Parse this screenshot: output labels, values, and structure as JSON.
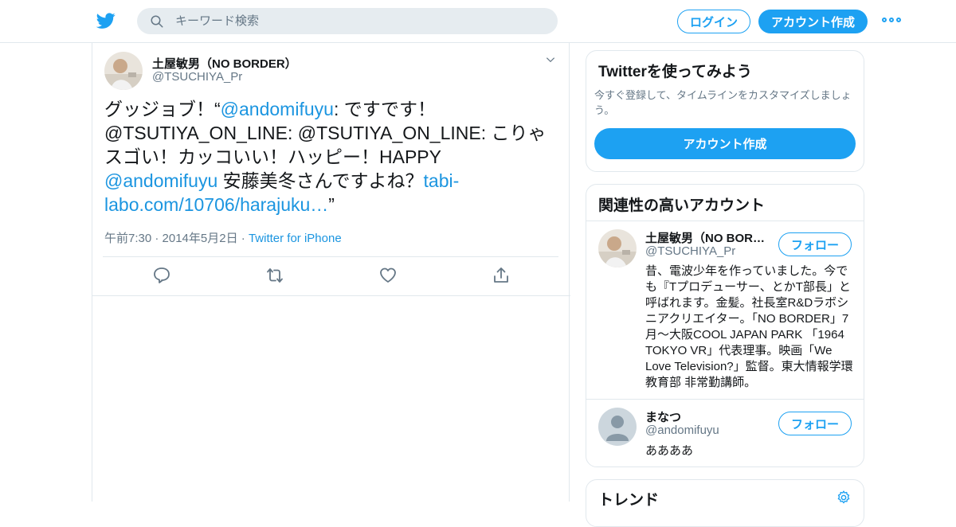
{
  "header": {
    "search_placeholder": "キーワード検索",
    "login_label": "ログイン",
    "signup_label": "アカウント作成"
  },
  "tweet": {
    "author_name": "土屋敏男（NO BORDER）",
    "author_handle": "@TSUCHIYA_Pr",
    "text_parts": {
      "p1": "グッジョブ！“",
      "mention1": "@andomifuyu",
      "p2": ": ですです！ @TSUTIYA_ON_LINE: @TSUTIYA_ON_LINE: こりゃスゴい！カッコいい！ハッピー！HAPPY ",
      "mention2": "@andomifuyu",
      "p3": " 安藤美冬さんですよね？",
      "link": "tabi-labo.com/10706/harajuku…",
      "p4": "”"
    },
    "timestamp": "午前7:30 · 2014年5月2日",
    "dot": "·",
    "source": "Twitter for iPhone"
  },
  "signup_card": {
    "title": "Twitterを使ってみよう",
    "subtitle": "今すぐ登録して、タイムラインをカスタマイズしましょう。",
    "button": "アカウント作成"
  },
  "related": {
    "title": "関連性の高いアカウント",
    "accounts": [
      {
        "name": "土屋敏男（NO BORDER）",
        "handle": "@TSUCHIYA_Pr",
        "follow": "フォロー",
        "bio": "昔、電波少年を作っていました。今でも『Tプロデューサー、とかT部長」と呼ばれます。金髪。社長室R&Dラボシニアクリエイター。「NO BORDER」7月〜大阪COOL JAPAN PARK 「1964 TOKYO VR」代表理事。映画「We Love Television?」監督。東大情報学環教育部 非常勤講師。"
      },
      {
        "name": "まなつ",
        "handle": "@andomifuyu",
        "follow": "フォロー",
        "bio": "ああああ"
      }
    ]
  },
  "trends": {
    "title": "トレンド"
  },
  "colors": {
    "accent": "#1da1f2",
    "link": "#1b95e0",
    "muted": "#657786",
    "border": "#e1e8ed"
  }
}
